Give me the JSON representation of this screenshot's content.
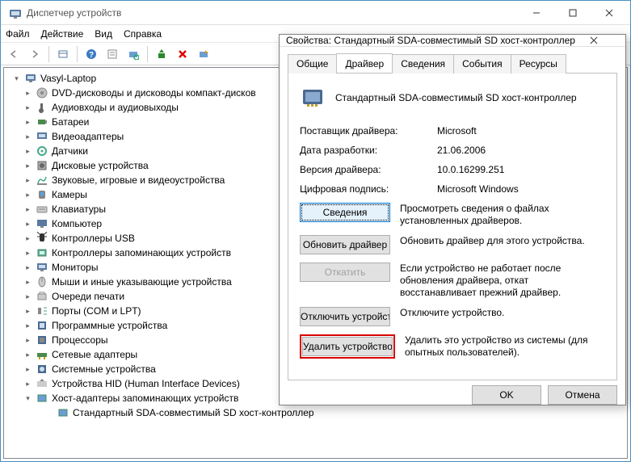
{
  "window": {
    "title": "Диспетчер устройств"
  },
  "menu": {
    "file": "Файл",
    "action": "Действие",
    "view": "Вид",
    "help": "Справка"
  },
  "tree": {
    "root": "Vasyl-Laptop",
    "items": [
      "DVD-дисководы и дисководы компакт-дисков",
      "Аудиовходы и аудиовыходы",
      "Батареи",
      "Видеоадаптеры",
      "Датчики",
      "Дисковые устройства",
      "Звуковые, игровые и видеоустройства",
      "Камеры",
      "Клавиатуры",
      "Компьютер",
      "Контроллеры USB",
      "Контроллеры запоминающих устройств",
      "Мониторы",
      "Мыши и иные указывающие устройства",
      "Очереди печати",
      "Порты (COM и LPT)",
      "Программные устройства",
      "Процессоры",
      "Сетевые адаптеры",
      "Системные устройства",
      "Устройства HID (Human Interface Devices)",
      "Хост-адаптеры запоминающих устройств"
    ],
    "child": "Стандартный SDA-совместимый SD хост-контроллер"
  },
  "dialog": {
    "title": "Свойства: Стандартный SDA-совместимый SD хост-контроллер",
    "tabs": {
      "general": "Общие",
      "driver": "Драйвер",
      "details": "Сведения",
      "events": "События",
      "resources": "Ресурсы"
    },
    "device_name": "Стандартный SDA-совместимый SD хост-контроллер",
    "rows": {
      "provider_lbl": "Поставщик драйвера:",
      "provider_val": "Microsoft",
      "date_lbl": "Дата разработки:",
      "date_val": "21.06.2006",
      "version_lbl": "Версия драйвера:",
      "version_val": "10.0.16299.251",
      "signer_lbl": "Цифровая подпись:",
      "signer_val": "Microsoft Windows"
    },
    "actions": {
      "details_btn": "Сведения",
      "details_desc": "Просмотреть сведения о файлах установленных драйверов.",
      "update_btn": "Обновить драйвер",
      "update_desc": "Обновить драйвер для этого устройства.",
      "rollback_btn": "Откатить",
      "rollback_desc": "Если устройство не работает после обновления драйвера, откат восстанавливает прежний драйвер.",
      "disable_btn": "Отключить устройство",
      "disable_desc": "Отключите устройство.",
      "uninstall_btn": "Удалить устройство",
      "uninstall_desc": "Удалить это устройство из системы (для опытных пользователей)."
    },
    "footer": {
      "ok": "OK",
      "cancel": "Отмена"
    }
  }
}
